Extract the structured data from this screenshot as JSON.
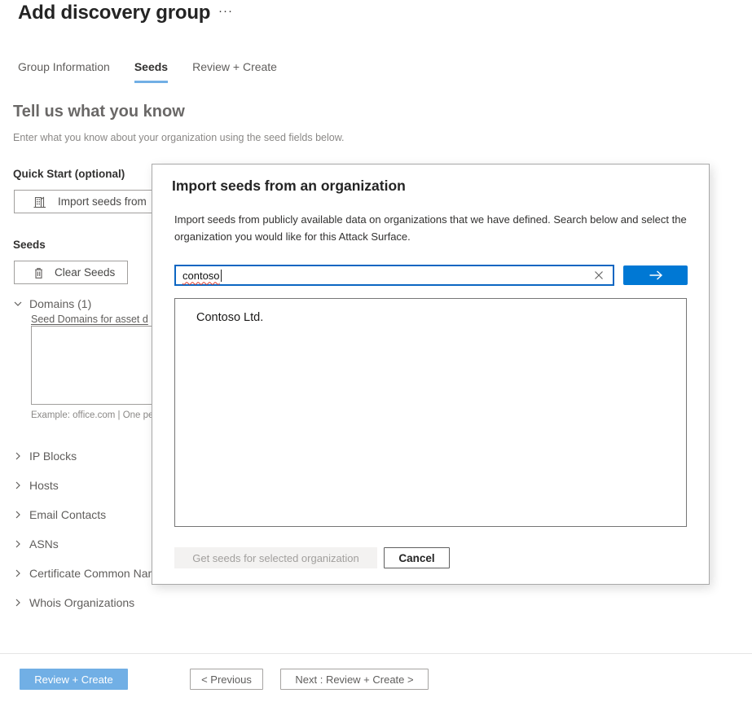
{
  "page": {
    "title": "Add discovery group",
    "more_options_label": "···",
    "tabs": [
      {
        "label": "Group Information"
      },
      {
        "label": "Seeds"
      },
      {
        "label": "Review + Create"
      }
    ],
    "intro": {
      "heading": "Tell us what you know",
      "description": "Enter what you know about your organization using the seed fields below."
    },
    "quick_start": {
      "label": "Quick Start (optional)",
      "import_button_label": "Import seeds from"
    },
    "seeds": {
      "label": "Seeds",
      "clear_button_label": "Clear Seeds",
      "domains": {
        "header": "Domains (1)",
        "field_label": "Seed Domains for asset d",
        "textarea_value": "",
        "helper_text": "Example: office.com | One per line"
      },
      "collapsed_sections": [
        "IP Blocks",
        "Hosts",
        "Email Contacts",
        "ASNs",
        "Certificate Common Names",
        "Whois Organizations"
      ]
    },
    "footer": {
      "review_create_label": "Review + Create",
      "previous_label": "< Previous",
      "next_label": "Next : Review + Create >"
    }
  },
  "modal": {
    "title": "Import seeds from an organization",
    "description": "Import seeds from publicly available data on organizations that we have defined. Search below and select the organization you would like for this Attack Surface.",
    "search": {
      "value": "contoso"
    },
    "results": [
      {
        "name": "Contoso Ltd."
      }
    ],
    "get_seeds_button_label": "Get seeds for selected organization",
    "cancel_button_label": "Cancel"
  },
  "colors": {
    "accent_blue": "#0078d4",
    "light_blue": "#71afe5",
    "spellcheck_red": "#dd3b2c",
    "disabled_button_bg": "#f3f2f1",
    "disabled_button_text": "#a19f9d"
  }
}
